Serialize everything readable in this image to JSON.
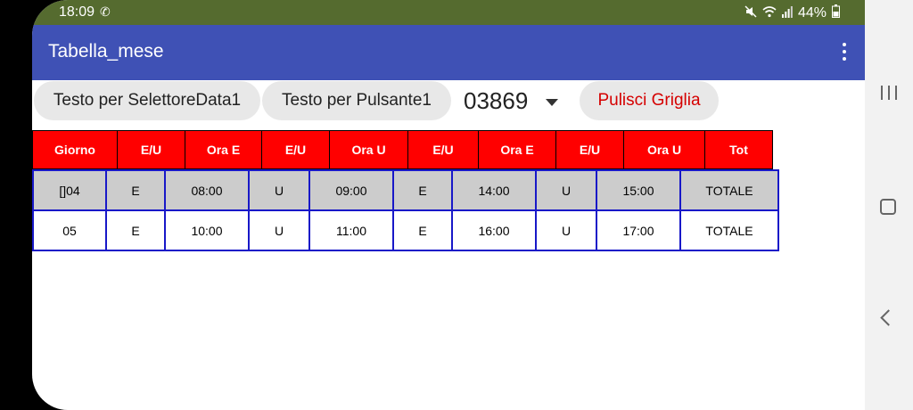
{
  "status_bar": {
    "time": "18:09",
    "call_icon": "phone-call-icon",
    "battery_percent": "44%",
    "icons": [
      "mute-icon",
      "wifi-icon",
      "signal-icon",
      "battery-icon"
    ]
  },
  "app_bar": {
    "title": "Tabella_mese",
    "menu_icon": "overflow-menu-icon"
  },
  "controls": {
    "date_selector_label": "Testo per SelettoreData1",
    "button1_label": "Testo per Pulsante1",
    "spinner_value": "03869",
    "clear_button_label": "Pulisci Griglia"
  },
  "header": [
    "Giorno",
    "E/U",
    "Ora E",
    "E/U",
    "Ora U",
    "E/U",
    "Ora E",
    "E/U",
    "Ora U",
    "Tot"
  ],
  "rows": [
    [
      "[]04",
      "E",
      "08:00",
      "U",
      "09:00",
      "E",
      "14:00",
      "U",
      "15:00",
      "TOTALE"
    ],
    [
      "05",
      "E",
      "10:00",
      "U",
      "11:00",
      "E",
      "16:00",
      "U",
      "17:00",
      "TOTALE"
    ]
  ],
  "colors": {
    "status_bar": "#556b2f",
    "app_bar": "#3f51b5",
    "header_bg": "#ff0000",
    "grid_border": "#1818c8",
    "clear_button_text": "#d50000"
  }
}
